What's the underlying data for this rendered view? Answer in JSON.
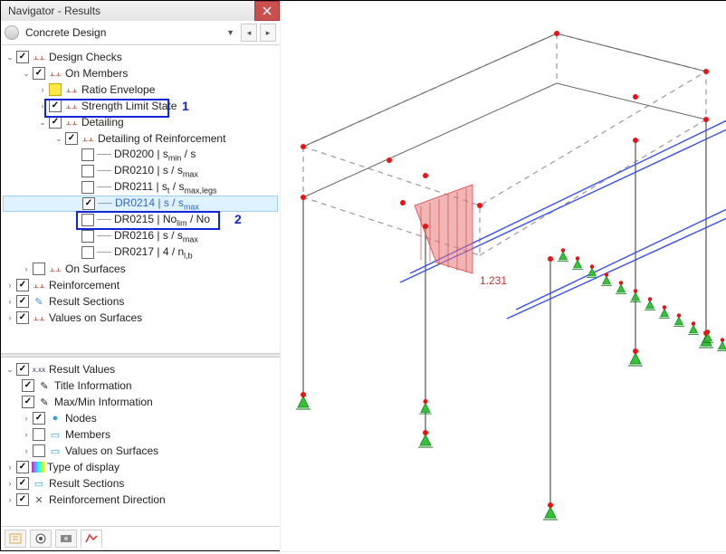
{
  "window": {
    "title": "Navigator - Results"
  },
  "combo": {
    "selected": "Concrete Design"
  },
  "tree": {
    "root": "Design Checks",
    "onMembers": "On Members",
    "ratioEnv": "Ratio Envelope",
    "strength": "Strength Limit State",
    "detailing": "Detailing",
    "detailReinf": "Detailing of Reinforcement",
    "dr0200a": "DR0200 | s",
    "dr0200b": " / s",
    "dr0210a": "DR0210 | s / s",
    "dr0211a": "DR0211 | s",
    "dr0211b": " / s",
    "dr0214a": "DR0214 | s / s",
    "dr0215a": "DR0215 | No",
    "dr0215b": " / No",
    "dr0216a": "DR0216 | s / s",
    "dr0217a": "DR0217 | 4 / n",
    "onSurfaces": "On Surfaces",
    "reinforcement": "Reinforcement",
    "resultSections": "Result Sections",
    "valuesOnSurfaces": "Values on Surfaces"
  },
  "opts": {
    "resultValues": "Result Values",
    "titleInfo": "Title Information",
    "maxMin": "Max/Min Information",
    "nodes": "Nodes",
    "members": "Members",
    "valuesOnSurfaces": "Values on Surfaces",
    "typeDisplay": "Type of display",
    "resultSections": "Result Sections",
    "reinfDir": "Reinforcement Direction"
  },
  "subs": {
    "min": "min",
    "max": "max",
    "t": "t",
    "maxlegs": "max,legs",
    "lim": "lim",
    "lb": "l,b"
  },
  "annotations": {
    "one": "1",
    "two": "2"
  },
  "viewport": {
    "ratioLabel": "1.231"
  }
}
